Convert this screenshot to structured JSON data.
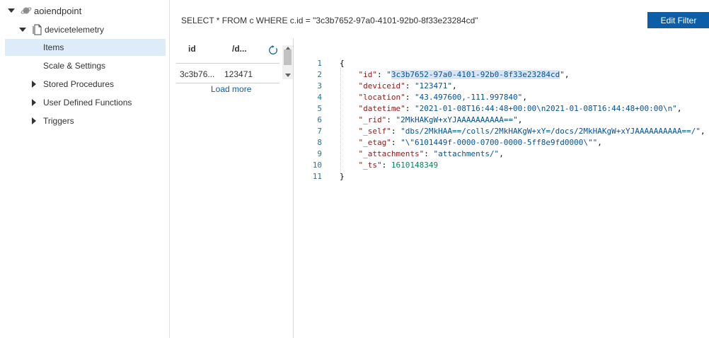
{
  "tree": {
    "database": "aoiendpoint",
    "collection": "devicetelemetry",
    "items": [
      "Items",
      "Scale & Settings"
    ],
    "groups": [
      "Stored Procedures",
      "User Defined Functions",
      "Triggers"
    ]
  },
  "query": {
    "text": "SELECT * FROM c WHERE c.id = \"3c3b7652-97a0-4101-92b0-8f33e23284cd\"",
    "button": "Edit Filter"
  },
  "results": {
    "columns": [
      "id",
      "/d..."
    ],
    "rows": [
      [
        "3c3b76...",
        "123471"
      ]
    ],
    "load_more": "Load more"
  },
  "document": {
    "open": "{",
    "close": "}",
    "lines": [
      {
        "key": "\"id\"",
        "value": "\"3c3b7652-97a0-4101-92b0-8f33e23284cd\"",
        "tail": ","
      },
      {
        "key": "\"deviceid\"",
        "value": "\"123471\"",
        "tail": ","
      },
      {
        "key": "\"location\"",
        "value": "\"43.497600,-111.997840\"",
        "tail": ","
      },
      {
        "key": "\"datetime\"",
        "value": "\"2021-01-08T16:44:48+00:00\\n2021-01-08T16:44:48+00:00\\n\"",
        "tail": ","
      },
      {
        "key": "\"_rid\"",
        "value": "\"2MkHAKgW+xYJAAAAAAAAAA==\"",
        "tail": ","
      },
      {
        "key": "\"_self\"",
        "value": "\"dbs/2MkHAA==/colls/2MkHAKgW+xY=/docs/2MkHAKgW+xYJAAAAAAAAAA==/\"",
        "tail": ","
      },
      {
        "key": "\"_etag\"",
        "value": "\"\\\"6101449f-0000-0700-0000-5ff8e9fd0000\\\"\"",
        "tail": ","
      },
      {
        "key": "\"_attachments\"",
        "value": "\"attachments/\"",
        "tail": ","
      },
      {
        "key": "\"_ts\"",
        "value": "1610148349",
        "tail": ""
      }
    ],
    "line_numbers": [
      "1",
      "2",
      "3",
      "4",
      "5",
      "6",
      "7",
      "8",
      "9",
      "10",
      "11"
    ]
  },
  "colors": {
    "accent": "#0d5ea8",
    "selected": "#deecf9",
    "json_key": "#a31515",
    "json_string": "#0451a5",
    "json_number": "#098658",
    "line_number": "#237893"
  },
  "icons": {
    "database": "planet-icon",
    "collection": "document-icon",
    "refresh": "refresh-icon"
  }
}
